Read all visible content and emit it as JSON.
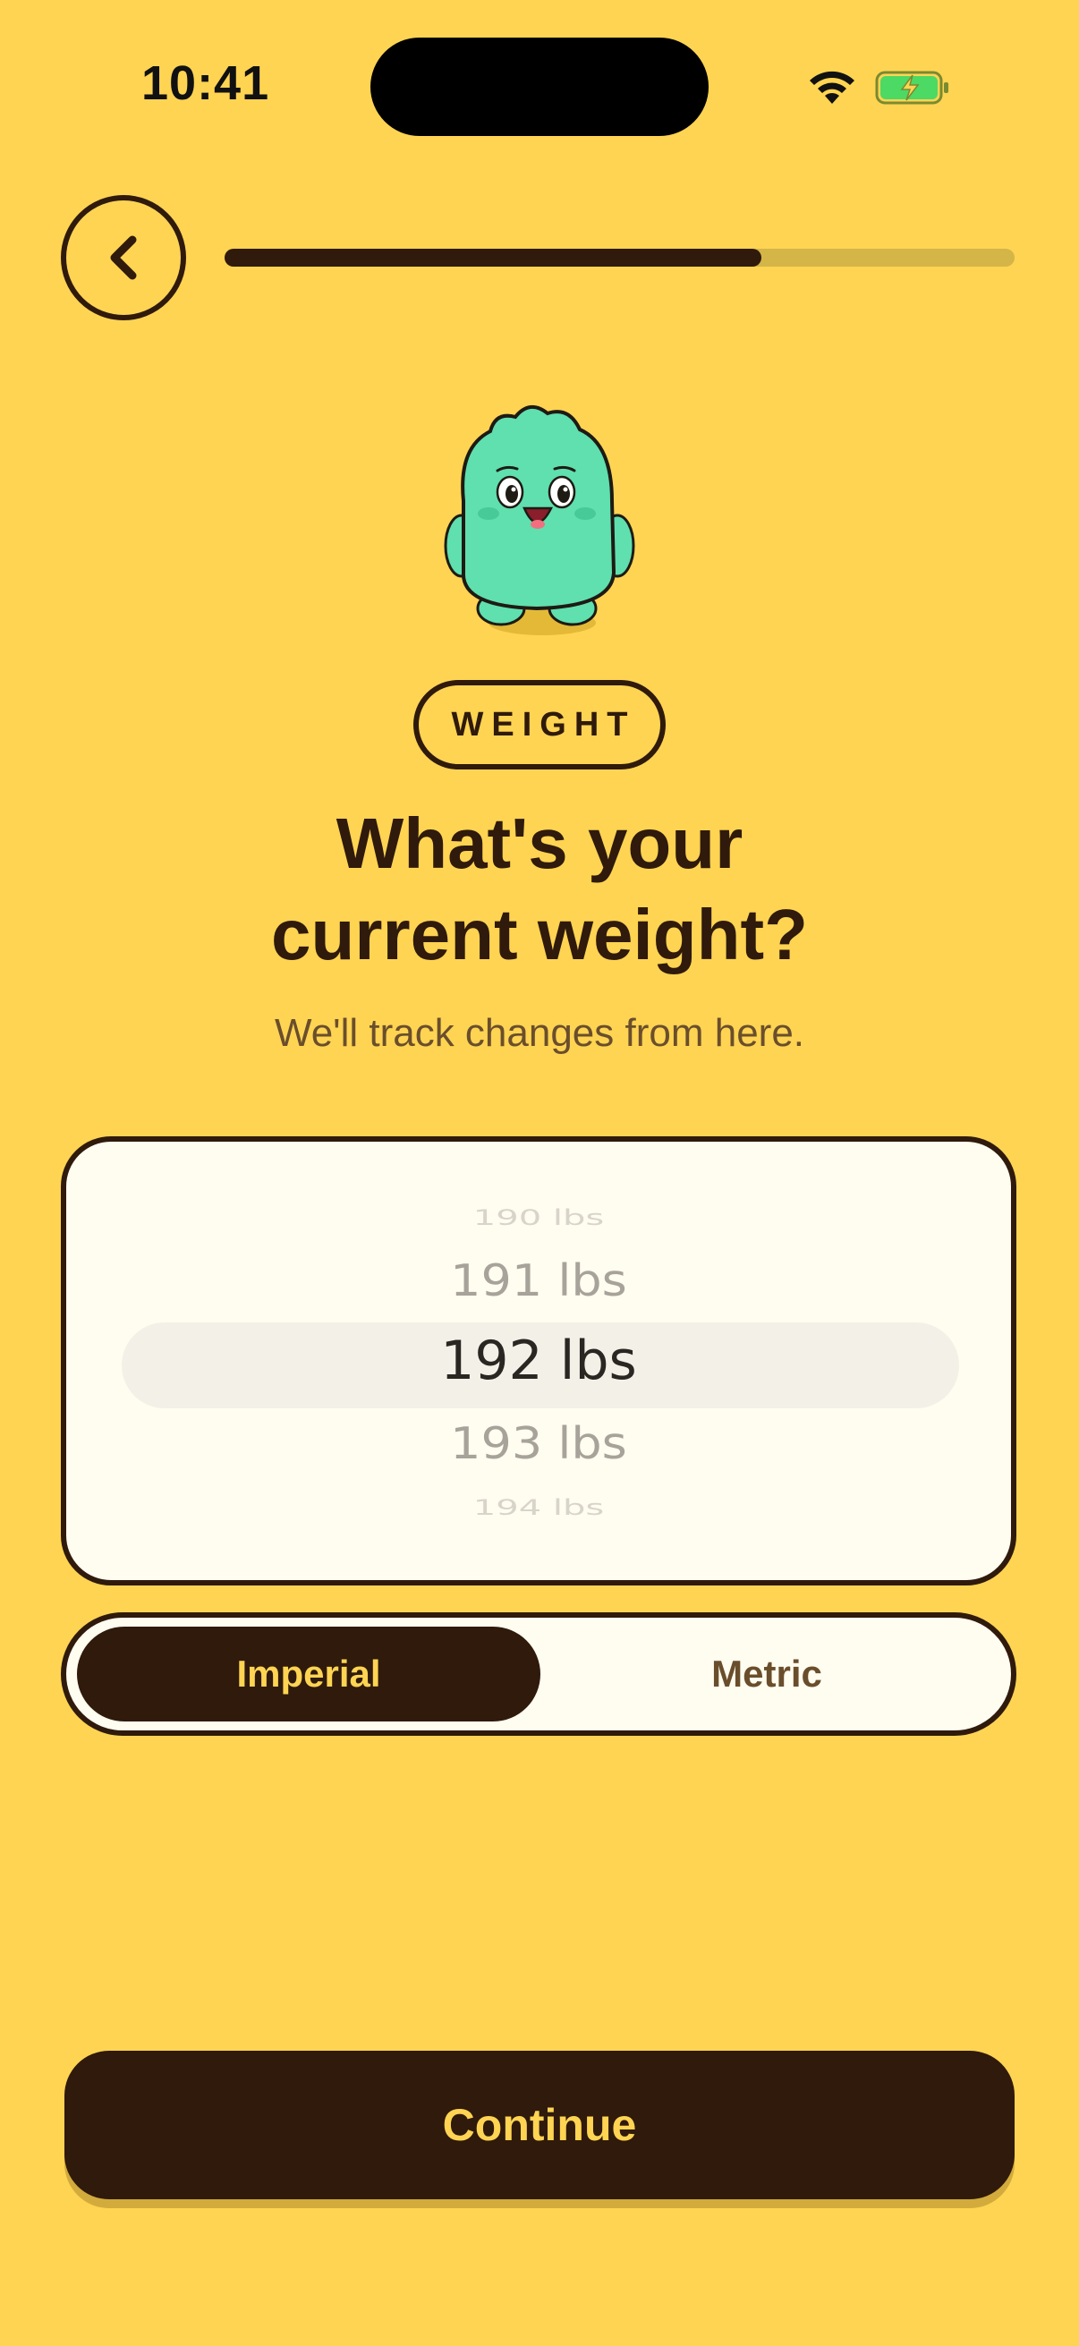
{
  "status_bar": {
    "time": "10:41",
    "wifi_icon": "wifi-icon",
    "battery_icon": "battery-charging-icon"
  },
  "header": {
    "back_icon": "chevron-left-icon",
    "progress": 0.68
  },
  "mascot": {
    "icon": "green-monster-mascot"
  },
  "tag": "WEIGHT",
  "headline": {
    "line1": "What's your",
    "line2": "current weight?"
  },
  "subtitle": "We'll track changes from here.",
  "picker": {
    "options": [
      "190 lbs",
      "191 lbs",
      "192 lbs",
      "193 lbs",
      "194 lbs"
    ],
    "selected": "192 lbs"
  },
  "units": {
    "imperial_label": "Imperial",
    "metric_label": "Metric",
    "selected": "Imperial"
  },
  "continue_label": "Continue",
  "colors": {
    "background": "#FED452",
    "ink": "#2F1A0C",
    "card": "#FFFCF0",
    "mascot": "#5FE0AE"
  }
}
